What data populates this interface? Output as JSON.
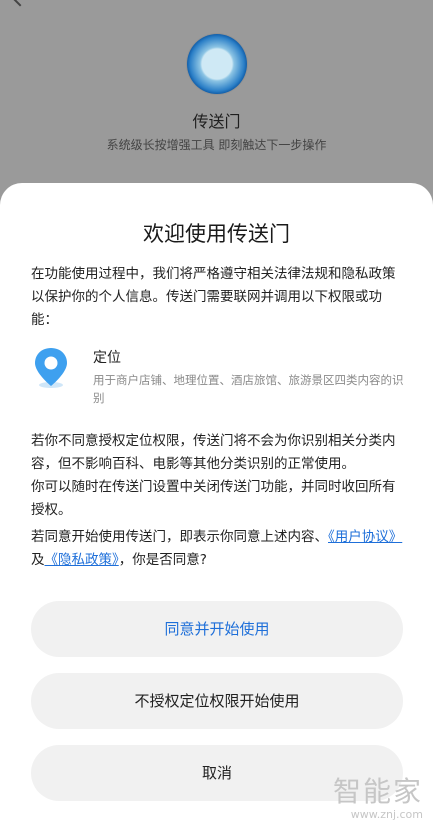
{
  "app": {
    "name": "传送门",
    "description": "系统级长按增强工具 即刻触达下一步操作"
  },
  "dialog": {
    "title": "欢迎使用传送门",
    "intro": "在功能使用过程中，我们将严格遵守相关法律法规和隐私政策以保护你的个人信息。传送门需要联网并调用以下权限或功能：",
    "permission": {
      "icon": "location-pin-icon",
      "title": "定位",
      "description": "用于商户店铺、地理位置、酒店旅馆、旅游景区四类内容的识别"
    },
    "notice_1": "若你不同意授权定位权限，传送门将不会为你识别相关分类内容，但不影响百科、电影等其他分类识别的正常使用。",
    "notice_2": "你可以随时在传送门设置中关闭传送门功能，并同时收回所有授权。",
    "consent": {
      "prefix": "若同意开始使用传送门，即表示你同意上述内容、",
      "user_agreement": "《用户协议》",
      "and": "及",
      "privacy_policy": "《隐私政策》",
      "suffix": "，你是否同意?"
    },
    "buttons": {
      "agree": "同意并开始使用",
      "deny_location": "不授权定位权限开始使用",
      "cancel": "取消"
    }
  },
  "watermark": {
    "logo": "智能家",
    "url": "www.znj.com"
  },
  "colors": {
    "accent": "#1e6fd9",
    "dim_background": "#9a9a9a",
    "sheet": "#ffffff",
    "button_bg": "#f1f1f1"
  }
}
